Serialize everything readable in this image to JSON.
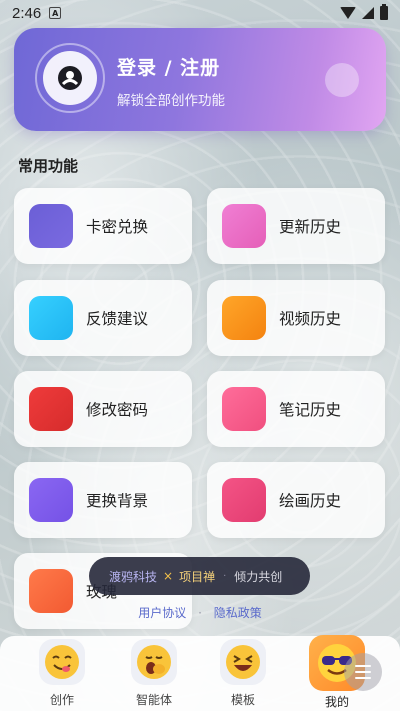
{
  "status_bar": {
    "time": "2:46",
    "indicator": "A"
  },
  "login": {
    "title": "登录 / 注册",
    "subtitle": "解锁全部创作功能",
    "avatar_icon": "user-icon"
  },
  "section": {
    "title": "常用功能"
  },
  "features": [
    {
      "label": "卡密兑换",
      "color_start": "#6b5fd6",
      "color_end": "#7a6ae0"
    },
    {
      "label": "更新历史",
      "color_start": "#f07fd4",
      "color_end": "#e55fb8"
    },
    {
      "label": "反馈建议",
      "color_start": "#36d0ff",
      "color_end": "#1fb4f0"
    },
    {
      "label": "视频历史",
      "color_start": "#ffa629",
      "color_end": "#f48310"
    },
    {
      "label": "修改密码",
      "color_start": "#ef3b3b",
      "color_end": "#d62c2c"
    },
    {
      "label": "笔记历史",
      "color_start": "#ff6d9a",
      "color_end": "#f04f7f"
    },
    {
      "label": "更换背景",
      "color_start": "#8a67f2",
      "color_end": "#7552e6"
    },
    {
      "label": "绘画历史",
      "color_start": "#f45486",
      "color_end": "#e23c70"
    },
    {
      "label": "玫瑰",
      "color_start": "#ff7a4a",
      "color_end": "#f25a32"
    }
  ],
  "toast": {
    "brand": "渡鸦科技",
    "star": "×",
    "brand2": "项目禅",
    "separator": "·",
    "tag": "倾力共创"
  },
  "links": {
    "user_agreement": "用户协议",
    "separator": "·",
    "privacy": "隐私政策"
  },
  "bottom_nav": [
    {
      "label": "创作",
      "icon": "yum-face-icon"
    },
    {
      "label": "智能体",
      "icon": "yawn-face-icon"
    },
    {
      "label": "模板",
      "icon": "laughing-face-icon"
    },
    {
      "label": "我的",
      "icon": "sunglasses-face-icon",
      "active": true
    }
  ]
}
